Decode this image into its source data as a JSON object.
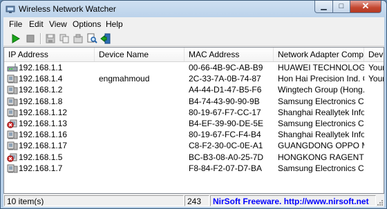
{
  "window": {
    "title": "Wireless Network Watcher"
  },
  "window_controls": {
    "minimize": "▁",
    "maximize": "□",
    "close": "✕"
  },
  "menu": [
    "File",
    "Edit",
    "View",
    "Options",
    "Help"
  ],
  "toolbar": {
    "icons": [
      "play-icon",
      "stop-icon",
      "save-icon",
      "copy-icon",
      "properties-icon",
      "find-icon",
      "exit-icon"
    ]
  },
  "columns": [
    "IP Address",
    "Device Name",
    "MAC Address",
    "Network Adapter Comp...",
    "Devi"
  ],
  "rows": [
    {
      "ip": "192.168.1.1",
      "device": "",
      "mac": "00-66-4B-9C-AB-B9",
      "company": "HUAWEI TECHNOLOGIE...",
      "info": "Your",
      "icon": "router"
    },
    {
      "ip": "192.168.1.4",
      "device": "engmahmoud",
      "mac": "2C-33-7A-0B-74-87",
      "company": "Hon Hai Precision Ind. C...",
      "info": "Your",
      "icon": "computer"
    },
    {
      "ip": "192.168.1.2",
      "device": "",
      "mac": "A4-44-D1-47-B5-F6",
      "company": "Wingtech Group (Hong...",
      "info": "",
      "icon": "computer"
    },
    {
      "ip": "192.168.1.8",
      "device": "",
      "mac": "B4-74-43-90-90-9B",
      "company": "Samsung Electronics Co...",
      "info": "",
      "icon": "computer"
    },
    {
      "ip": "192.168.1.12",
      "device": "",
      "mac": "80-19-67-F7-CC-17",
      "company": "Shanghai Reallytek Infor...",
      "info": "",
      "icon": "computer"
    },
    {
      "ip": "192.168.1.13",
      "device": "",
      "mac": "B4-EF-39-90-DE-5E",
      "company": "Samsung Electronics Co...",
      "info": "",
      "icon": "disconnected"
    },
    {
      "ip": "192.168.1.16",
      "device": "",
      "mac": "80-19-67-FC-F4-B4",
      "company": "Shanghai Reallytek Infor...",
      "info": "",
      "icon": "computer"
    },
    {
      "ip": "192.168.1.17",
      "device": "",
      "mac": "C8-F2-30-0C-0E-A1",
      "company": "GUANGDONG OPPO M...",
      "info": "",
      "icon": "computer"
    },
    {
      "ip": "192.168.1.5",
      "device": "",
      "mac": "BC-B3-08-A0-25-7D",
      "company": "HONGKONG RAGENTEK...",
      "info": "",
      "icon": "disconnected"
    },
    {
      "ip": "192.168.1.7",
      "device": "",
      "mac": "F8-84-F2-07-D7-BA",
      "company": "Samsung Electronics Co...",
      "info": "",
      "icon": "computer"
    }
  ],
  "status": {
    "items": "10 item(s)",
    "count": "243",
    "link": "NirSoft Freeware.  http://www.nirsoft.net"
  }
}
